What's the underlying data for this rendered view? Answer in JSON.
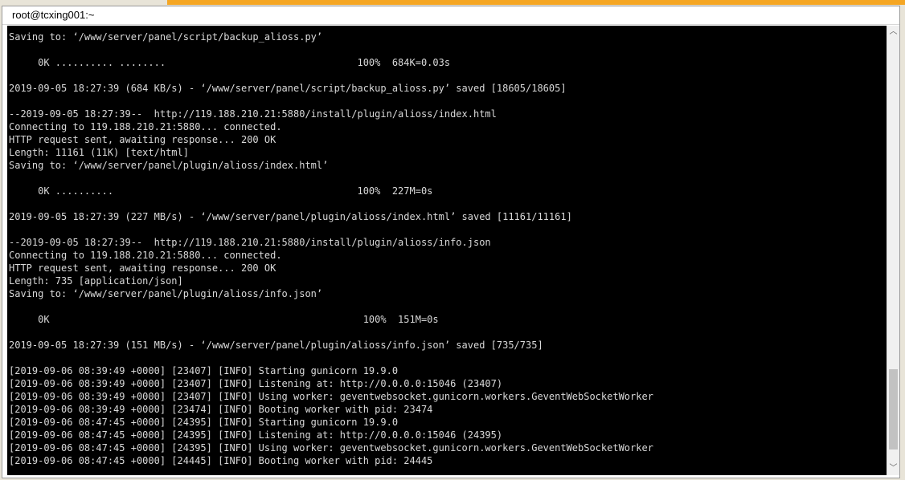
{
  "window": {
    "title": "root@tcxing001:~"
  },
  "terminal": {
    "lines": [
      "Saving to: ‘/www/server/panel/script/backup_alioss.py’",
      "",
      "     0K .......... ........                                 100%  684K=0.03s",
      "",
      "2019-09-05 18:27:39 (684 KB/s) - ‘/www/server/panel/script/backup_alioss.py’ saved [18605/18605]",
      "",
      "--2019-09-05 18:27:39--  http://119.188.210.21:5880/install/plugin/alioss/index.html",
      "Connecting to 119.188.210.21:5880... connected.",
      "HTTP request sent, awaiting response... 200 OK",
      "Length: 11161 (11K) [text/html]",
      "Saving to: ‘/www/server/panel/plugin/alioss/index.html’",
      "",
      "     0K ..........                                          100%  227M=0s",
      "",
      "2019-09-05 18:27:39 (227 MB/s) - ‘/www/server/panel/plugin/alioss/index.html’ saved [11161/11161]",
      "",
      "--2019-09-05 18:27:39--  http://119.188.210.21:5880/install/plugin/alioss/info.json",
      "Connecting to 119.188.210.21:5880... connected.",
      "HTTP request sent, awaiting response... 200 OK",
      "Length: 735 [application/json]",
      "Saving to: ‘/www/server/panel/plugin/alioss/info.json’",
      "",
      "     0K                                                      100%  151M=0s",
      "",
      "2019-09-05 18:27:39 (151 MB/s) - ‘/www/server/panel/plugin/alioss/info.json’ saved [735/735]",
      "",
      "[2019-09-06 08:39:49 +0000] [23407] [INFO] Starting gunicorn 19.9.0",
      "[2019-09-06 08:39:49 +0000] [23407] [INFO] Listening at: http://0.0.0.0:15046 (23407)",
      "[2019-09-06 08:39:49 +0000] [23407] [INFO] Using worker: geventwebsocket.gunicorn.workers.GeventWebSocketWorker",
      "[2019-09-06 08:39:49 +0000] [23474] [INFO] Booting worker with pid: 23474",
      "[2019-09-06 08:47:45 +0000] [24395] [INFO] Starting gunicorn 19.9.0",
      "[2019-09-06 08:47:45 +0000] [24395] [INFO] Listening at: http://0.0.0.0:15046 (24395)",
      "[2019-09-06 08:47:45 +0000] [24395] [INFO] Using worker: geventwebsocket.gunicorn.workers.GeventWebSocketWorker",
      "[2019-09-06 08:47:45 +0000] [24445] [INFO] Booting worker with pid: 24445"
    ]
  },
  "scrollbar": {
    "up_icon": "chevron-up-icon",
    "down_icon": "chevron-down-icon",
    "up_glyph": "︿",
    "down_glyph": "﹀"
  },
  "colors": {
    "terminal_background": "#000000",
    "terminal_text": "#d9d9d9",
    "accent": "#f5a623"
  }
}
